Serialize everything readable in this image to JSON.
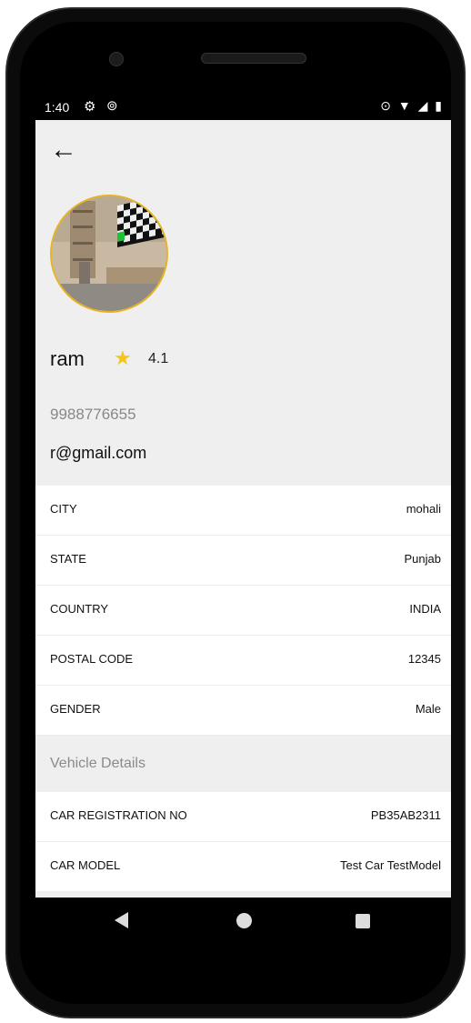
{
  "status_bar": {
    "time": "1:40",
    "settings_icon": "gear-icon",
    "sync_icon": "sync-icon",
    "right_icons": [
      "location-icon",
      "wifi-icon",
      "signal-icon",
      "battery-icon"
    ]
  },
  "profile": {
    "name": "ram",
    "rating": "4.1",
    "phone": "9988776655",
    "email": "r@gmail.com"
  },
  "details": [
    {
      "label": "CITY",
      "value": "mohali"
    },
    {
      "label": "STATE",
      "value": "Punjab"
    },
    {
      "label": "COUNTRY",
      "value": "INDIA"
    },
    {
      "label": "POSTAL CODE",
      "value": "12345"
    },
    {
      "label": "GENDER",
      "value": "Male"
    }
  ],
  "vehicle": {
    "section_title": "Vehicle Details",
    "rows": [
      {
        "label": "CAR REGISTRATION NO",
        "value": "PB35AB2311"
      },
      {
        "label": "CAR MODEL",
        "value": "Test Car TestModel"
      }
    ]
  },
  "colors": {
    "avatar_border": "#e7b421",
    "star": "#f5c518",
    "header_bg": "#efefef"
  }
}
